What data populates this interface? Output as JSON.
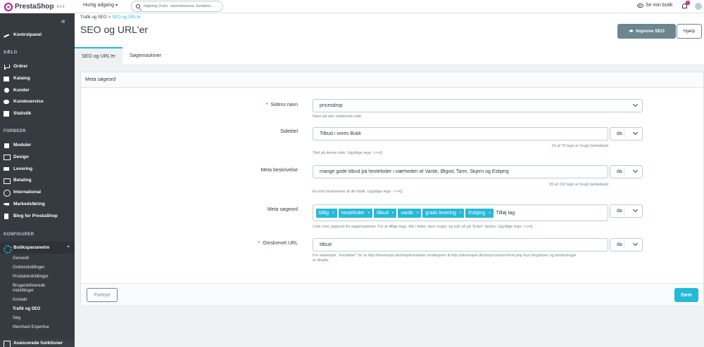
{
  "header": {
    "logo_text": "PrestaShop",
    "version": "8.0.4",
    "quick_access": "Hurtig adgang",
    "search_placeholder": "Søgning (f.eks. varereference, kundens...",
    "view_shop": "Se min butik",
    "notifications_count": "1"
  },
  "sidebar": {
    "dashboard": "Kontrolpanel",
    "section_sell": "SÆLG",
    "sell_items": [
      "Ordrer",
      "Katalog",
      "Kunder",
      "Kundeservice",
      "Statistik"
    ],
    "section_improve": "FORBEDR",
    "improve_items": [
      "Moduler",
      "Design",
      "Levering",
      "Betaling",
      "International",
      "Markedsføring",
      "Blog for PrestaShop"
    ],
    "section_configure": "KONFIGURER",
    "active_parent": "Butiksparametre",
    "sub_items": [
      "Generelt",
      "Ordreindstillinger",
      "Produktindstillinger",
      "Brugerdefinerede",
      "indstillinger",
      "Kontakt",
      "Trafik og SEO",
      "Søg",
      "Merchant Expertise"
    ],
    "advanced": "Avancerede funktioner"
  },
  "page": {
    "breadcrumb_parent": "Trafik og SEO",
    "breadcrumb_sep": ">",
    "breadcrumb_current": "SEO og URL'er",
    "title": "SEO og URL'er",
    "improve_seo": "Improve SEO",
    "help": "Hjælp",
    "tabs": [
      "SEO og URL'er",
      "Søgemaskiner"
    ]
  },
  "panel": {
    "title": "Meta søgeord",
    "page_name": {
      "label": "Sidens navn",
      "value": "pricesdrop",
      "help": "Navn på den relaterede side."
    },
    "page_title": {
      "label": "Sidetitel",
      "value": "Tilbud i vores Butik",
      "lang": "da",
      "counter": "20 af 70 tegn er brugt (anbefalet)",
      "help": "Titel på denne side. Ugyldige tegn: <>={}"
    },
    "meta_description": {
      "label": "Meta beskrivelse",
      "value": "mange gode tilbud på hestefoder i nærheden af Varde, Ølgod, Tarm, Skjern og Esbjerg",
      "lang": "da",
      "counter": "83 af 160 tegn er brugt (anbefalet)",
      "help": "En kort beskrivelse af din butik. Ugyldige tegn: <>={}"
    },
    "meta_keywords": {
      "label": "Meta søgeord",
      "tags": [
        "billig",
        "hestefoder",
        "tilbud",
        "varde",
        "gratis levering",
        "Esbjerg"
      ],
      "tag_remove": "x",
      "add_placeholder": "Tilføj tag",
      "lang": "da",
      "help": "Liste over søgeord for søgemaskiner. For at tilføje tags, klik i feltet, skriv noget, og tryk så på \"Enter\" tasten. Ugyldige tegn: <>={}"
    },
    "rewritten_url": {
      "label": "Omskrevet URL",
      "value": "tilbud",
      "lang": "da",
      "help_line1": "For eksempel, \"kontakter\" for at http://eksempel.dk/shop/kontakter omdirigerer til http://eksempel.dk/shop/contact-form.php Kun bogstaver og bindestreger",
      "help_line2": "er tilladte."
    },
    "cancel": "Fortryd",
    "save": "Gem"
  }
}
